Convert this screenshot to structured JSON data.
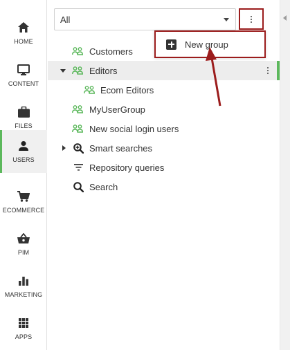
{
  "nav": {
    "items": [
      {
        "label": "HOME",
        "icon": "home-icon"
      },
      {
        "label": "CONTENT",
        "icon": "monitor-icon"
      },
      {
        "label": "FILES",
        "icon": "briefcase-icon"
      },
      {
        "label": "USERS",
        "icon": "user-icon",
        "active": true
      },
      {
        "label": "ECOMMERCE",
        "icon": "cart-icon"
      },
      {
        "label": "PIM",
        "icon": "basket-icon"
      },
      {
        "label": "MARKETING",
        "icon": "bar-chart-icon"
      },
      {
        "label": "APPS",
        "icon": "grid-icon"
      }
    ]
  },
  "filter": {
    "selected": "All"
  },
  "menu": {
    "new_group_label": "New group"
  },
  "tree": {
    "items": [
      {
        "label": "Customers",
        "icon": "user-group-icon"
      },
      {
        "label": "Editors",
        "icon": "user-group-icon",
        "expanded": true,
        "selected": true
      },
      {
        "label": "Ecom Editors",
        "icon": "user-group-icon"
      },
      {
        "label": "MyUserGroup",
        "icon": "user-group-icon"
      },
      {
        "label": "New social login users",
        "icon": "user-group-icon"
      },
      {
        "label": "Smart searches",
        "icon": "search-plus-icon",
        "expandable": true
      },
      {
        "label": "Repository queries",
        "icon": "filter-icon"
      },
      {
        "label": "Search",
        "icon": "search-icon"
      }
    ]
  },
  "colors": {
    "accent": "#5cb85c",
    "highlight": "#9b1c1c",
    "selected_bg": "#ededed"
  }
}
